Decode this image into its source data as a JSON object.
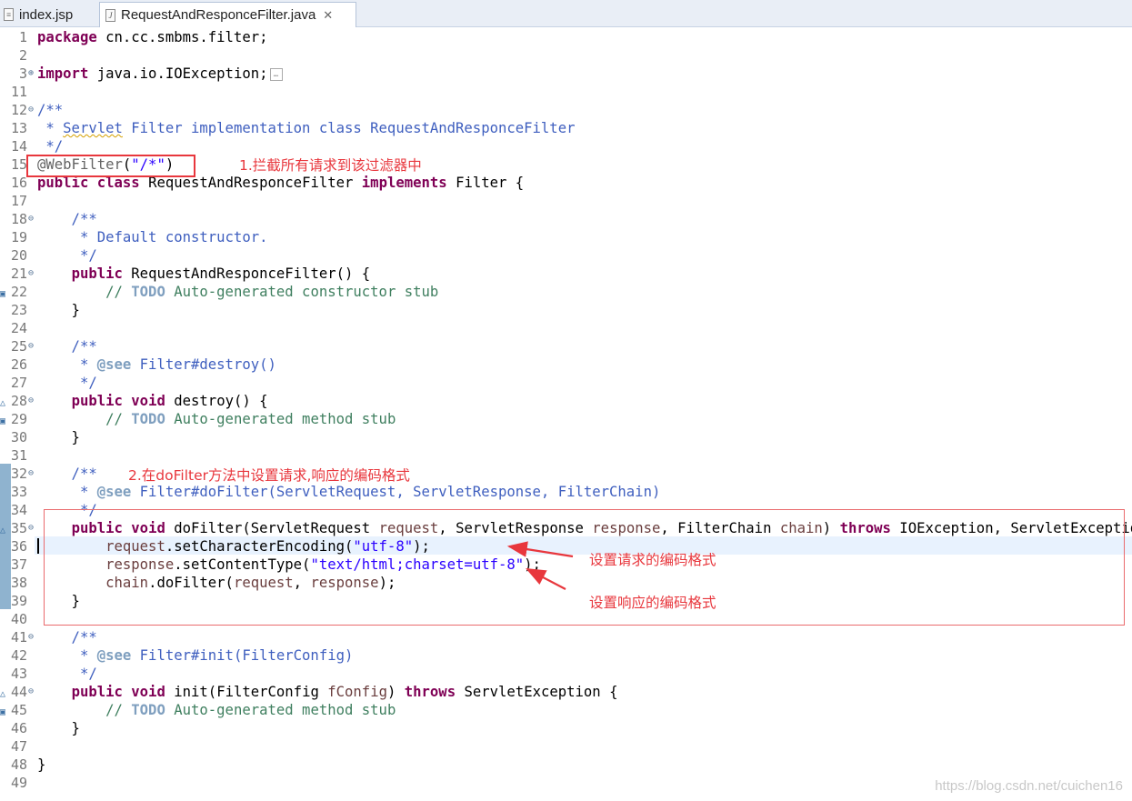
{
  "tabs": [
    {
      "label": "index.jsp",
      "active": false
    },
    {
      "label": "RequestAndResponceFilter.java",
      "active": true,
      "close": "✕"
    }
  ],
  "lines": [
    {
      "n": "1",
      "segs": [
        [
          "kw",
          "package"
        ],
        [
          "",
          " cn.cc.smbms.filter;"
        ]
      ]
    },
    {
      "n": "2",
      "segs": []
    },
    {
      "n": "3",
      "marker": "⊕",
      "segs": [
        [
          "kw",
          "import"
        ],
        [
          "",
          " java.io.IOException;"
        ]
      ],
      "fold": true
    },
    {
      "n": "11",
      "segs": []
    },
    {
      "n": "12",
      "marker": "⊖",
      "segs": [
        [
          "cm",
          "/**"
        ]
      ]
    },
    {
      "n": "13",
      "segs": [
        [
          "cm",
          " * "
        ],
        [
          "cm squiggle",
          "Servlet"
        ],
        [
          "cm",
          " Filter implementation class RequestAndResponceFilter"
        ]
      ]
    },
    {
      "n": "14",
      "segs": [
        [
          "cm",
          " */"
        ]
      ]
    },
    {
      "n": "15",
      "segs": [
        [
          "ann",
          "@WebFilter"
        ],
        [
          "",
          "("
        ],
        [
          "str",
          "\"/*\""
        ],
        [
          "",
          ")"
        ]
      ]
    },
    {
      "n": "16",
      "segs": [
        [
          "kw",
          "public"
        ],
        [
          "",
          " "
        ],
        [
          "kw",
          "class"
        ],
        [
          "",
          " RequestAndResponceFilter "
        ],
        [
          "kw",
          "implements"
        ],
        [
          "",
          " Filter {"
        ]
      ]
    },
    {
      "n": "17",
      "segs": []
    },
    {
      "n": "18",
      "marker": "⊖",
      "segs": [
        [
          "cm",
          "    /**"
        ]
      ]
    },
    {
      "n": "19",
      "segs": [
        [
          "cm",
          "     * Default constructor."
        ]
      ]
    },
    {
      "n": "20",
      "segs": [
        [
          "cm",
          "     */"
        ]
      ]
    },
    {
      "n": "21",
      "marker": "⊖",
      "segs": [
        [
          "",
          "    "
        ],
        [
          "kw",
          "public"
        ],
        [
          "",
          " RequestAndResponceFilter() {"
        ]
      ]
    },
    {
      "n": "22",
      "lmark": "task",
      "segs": [
        [
          "lc",
          "        // "
        ],
        [
          "todo",
          "TODO"
        ],
        [
          "lc",
          " Auto-generated constructor stub"
        ]
      ]
    },
    {
      "n": "23",
      "segs": [
        [
          "",
          "    }"
        ]
      ]
    },
    {
      "n": "24",
      "segs": []
    },
    {
      "n": "25",
      "marker": "⊖",
      "segs": [
        [
          "cm",
          "    /**"
        ]
      ]
    },
    {
      "n": "26",
      "segs": [
        [
          "cm",
          "     * "
        ],
        [
          "tag",
          "@see"
        ],
        [
          "cm",
          " Filter#destroy()"
        ]
      ]
    },
    {
      "n": "27",
      "segs": [
        [
          "cm",
          "     */"
        ]
      ]
    },
    {
      "n": "28",
      "lmark": "override",
      "marker": "⊖",
      "segs": [
        [
          "",
          "    "
        ],
        [
          "kw",
          "public"
        ],
        [
          "",
          " "
        ],
        [
          "kw",
          "void"
        ],
        [
          "",
          " destroy() {"
        ]
      ]
    },
    {
      "n": "29",
      "lmark": "task",
      "segs": [
        [
          "lc",
          "        // "
        ],
        [
          "todo",
          "TODO"
        ],
        [
          "lc",
          " Auto-generated method stub"
        ]
      ]
    },
    {
      "n": "30",
      "segs": [
        [
          "",
          "    }"
        ]
      ]
    },
    {
      "n": "31",
      "segs": []
    },
    {
      "n": "32",
      "marker": "⊖",
      "segs": [
        [
          "cm",
          "    /**"
        ]
      ]
    },
    {
      "n": "33",
      "segs": [
        [
          "cm",
          "     * "
        ],
        [
          "tag",
          "@see"
        ],
        [
          "cm",
          " Filter#doFilter(ServletRequest, ServletResponse, FilterChain)"
        ]
      ]
    },
    {
      "n": "34",
      "segs": [
        [
          "cm",
          "     */"
        ]
      ]
    },
    {
      "n": "35",
      "lmark": "override",
      "marker": "⊖",
      "segs": [
        [
          "",
          "    "
        ],
        [
          "kw",
          "public"
        ],
        [
          "",
          " "
        ],
        [
          "kw",
          "void"
        ],
        [
          "",
          " doFilter(ServletRequest "
        ],
        [
          "par",
          "request"
        ],
        [
          "",
          ", ServletResponse "
        ],
        [
          "par",
          "response"
        ],
        [
          "",
          ", FilterChain "
        ],
        [
          "par",
          "chain"
        ],
        [
          "",
          ") "
        ],
        [
          "kw",
          "throws"
        ],
        [
          "",
          " IOException, ServletException {"
        ]
      ]
    },
    {
      "n": "36",
      "segs": [
        [
          "",
          "        "
        ],
        [
          "par",
          "request"
        ],
        [
          "",
          ".setCharacterEncoding("
        ],
        [
          "str",
          "\"utf-8\""
        ],
        [
          "",
          ");"
        ]
      ]
    },
    {
      "n": "37",
      "segs": [
        [
          "",
          "        "
        ],
        [
          "par",
          "response"
        ],
        [
          "",
          ".setContentType("
        ],
        [
          "str",
          "\"text/html;charset=utf-8\""
        ],
        [
          "",
          ");"
        ]
      ]
    },
    {
      "n": "38",
      "segs": [
        [
          "",
          "        "
        ],
        [
          "par",
          "chain"
        ],
        [
          "",
          ".doFilter("
        ],
        [
          "par",
          "request"
        ],
        [
          "",
          ", "
        ],
        [
          "par",
          "response"
        ],
        [
          "",
          ");"
        ]
      ]
    },
    {
      "n": "39",
      "segs": [
        [
          "",
          "    }"
        ]
      ]
    },
    {
      "n": "40",
      "segs": []
    },
    {
      "n": "41",
      "marker": "⊖",
      "segs": [
        [
          "cm",
          "    /**"
        ]
      ]
    },
    {
      "n": "42",
      "segs": [
        [
          "cm",
          "     * "
        ],
        [
          "tag",
          "@see"
        ],
        [
          "cm",
          " Filter#init(FilterConfig)"
        ]
      ]
    },
    {
      "n": "43",
      "segs": [
        [
          "cm",
          "     */"
        ]
      ]
    },
    {
      "n": "44",
      "lmark": "override",
      "marker": "⊖",
      "segs": [
        [
          "",
          "    "
        ],
        [
          "kw",
          "public"
        ],
        [
          "",
          " "
        ],
        [
          "kw",
          "void"
        ],
        [
          "",
          " init(FilterConfig "
        ],
        [
          "par",
          "fConfig"
        ],
        [
          "",
          ") "
        ],
        [
          "kw",
          "throws"
        ],
        [
          "",
          " ServletException {"
        ]
      ]
    },
    {
      "n": "45",
      "lmark": "task",
      "segs": [
        [
          "lc",
          "        // "
        ],
        [
          "todo",
          "TODO"
        ],
        [
          "lc",
          " Auto-generated method stub"
        ]
      ]
    },
    {
      "n": "46",
      "segs": [
        [
          "",
          "    }"
        ]
      ]
    },
    {
      "n": "47",
      "segs": []
    },
    {
      "n": "48",
      "segs": [
        [
          "",
          "}"
        ]
      ]
    },
    {
      "n": "49",
      "segs": []
    }
  ],
  "notes": {
    "note1": "1.拦截所有请求到该过滤器中",
    "note2": "2.在doFilter方法中设置请求,响应的编码格式",
    "note3": "设置请求的编码格式",
    "note4": "设置响应的编码格式"
  },
  "watermark": "https://blog.csdn.net/cuichen16",
  "colors": {
    "keyword": "#7f0055",
    "javadoc": "#3f5fbf",
    "comment": "#3f7f5f",
    "string": "#2a00ff",
    "annotation_red": "#e8373d"
  }
}
